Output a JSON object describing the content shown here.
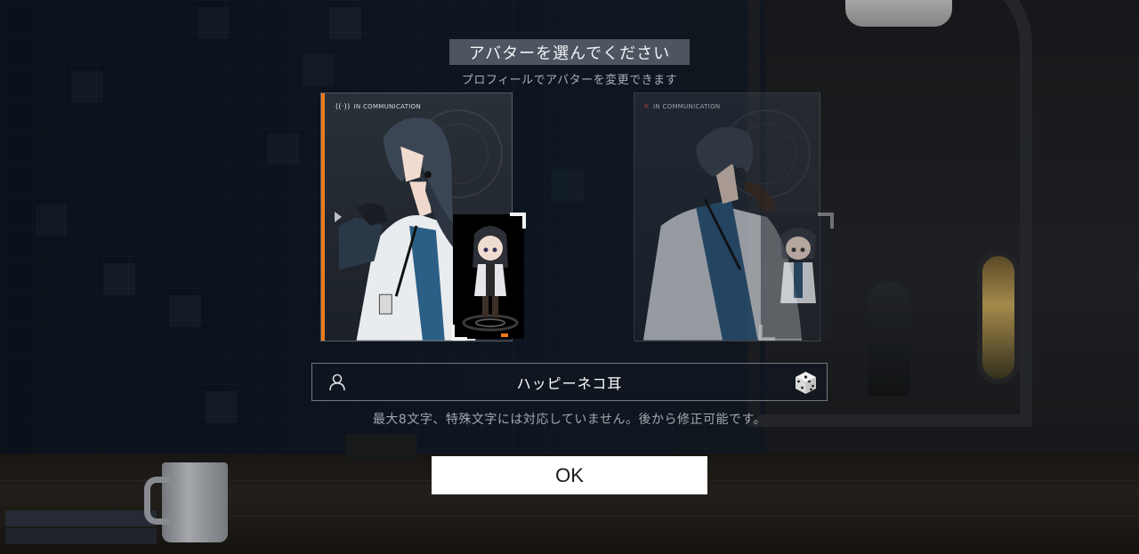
{
  "dialog": {
    "title": "アバターを選んでください",
    "subtitle": "プロフィールでアバターを変更できます"
  },
  "avatars": [
    {
      "status_label": "IN COMMUNICATION",
      "status_icon": "signal-icon",
      "selected": true
    },
    {
      "status_label": "IN COMMUNICATION",
      "status_icon": "close-x-icon",
      "selected": false
    }
  ],
  "name_field": {
    "value": "ハッピーネコ耳",
    "left_icon": "user-icon",
    "right_icon": "dice-icon"
  },
  "hint": "最大8文字、特殊文字には対応していません。後から修正可能です。",
  "ok_button": {
    "label": "OK"
  },
  "colors": {
    "accent": "#f07a1b",
    "button_bg": "#ffffff",
    "title_box_bg": "#58606c"
  }
}
